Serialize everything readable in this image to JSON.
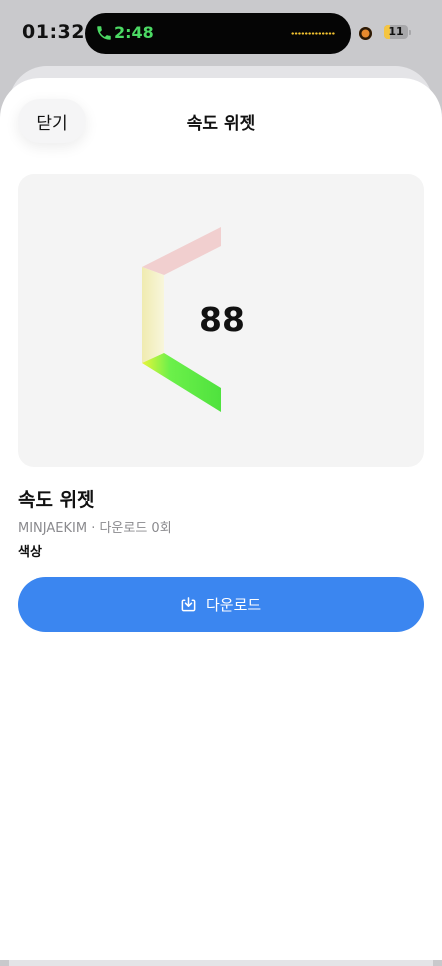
{
  "status_bar": {
    "time": "01:32",
    "call_time": "2:48",
    "battery": "11"
  },
  "sheet": {
    "close_label": "닫기",
    "title": "속도 위젯"
  },
  "preview": {
    "speed": "88"
  },
  "widget": {
    "name": "속도 위젯",
    "meta": "MINJAEKIM · 다운로드 0회",
    "color_label": "색상"
  },
  "download": {
    "label": "다운로드"
  },
  "colors": {
    "accent": "#3b86f0",
    "call_green": "#4cd964",
    "segment_red": "#f1cfcf",
    "segment_yellow": "#f6f3c8",
    "segment_green": "#5be84a"
  }
}
